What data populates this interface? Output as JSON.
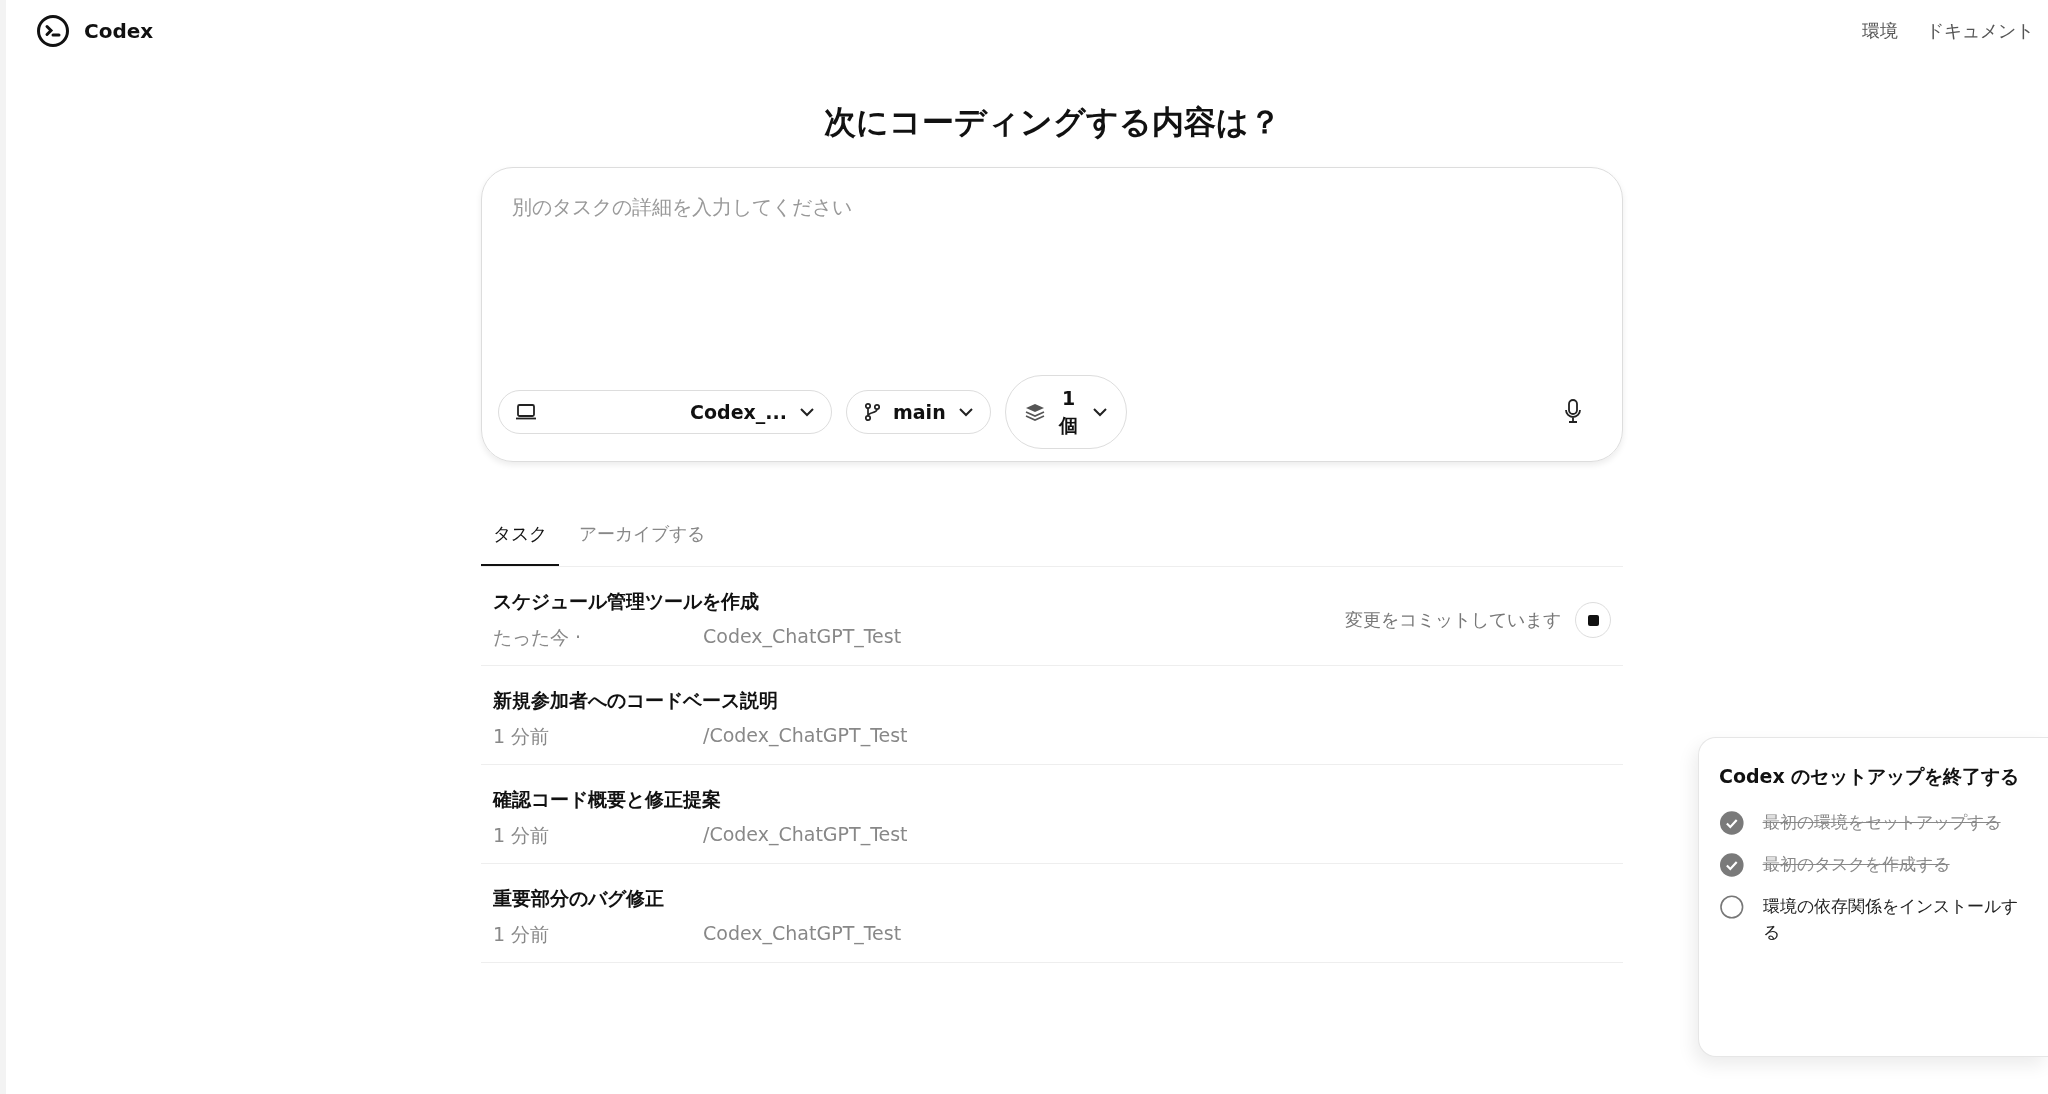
{
  "header": {
    "brand": "Codex",
    "links": [
      "環境",
      "ドキュメント"
    ]
  },
  "heading": "次にコーディングする内容は？",
  "composer": {
    "placeholder": "別のタスクの詳細を入力してください",
    "environment": "Codex_...",
    "branch": "main",
    "versions": "1 個"
  },
  "tabs": [
    {
      "label": "タスク",
      "selected": true
    },
    {
      "label": "アーカイブする",
      "selected": false
    }
  ],
  "tasks": [
    {
      "title": "スケジュール管理ツールを作成",
      "time": "たった今 ·",
      "repo": "Codex_ChatGPT_Test",
      "status": "変更をコミットしています"
    },
    {
      "title": "新規参加者へのコードベース説明",
      "time": "1 分前",
      "repo": "/Codex_ChatGPT_Test"
    },
    {
      "title": "確認コード概要と修正提案",
      "time": "1 分前",
      "repo": "/Codex_ChatGPT_Test"
    },
    {
      "title": "重要部分のバグ修正",
      "time": "1 分前",
      "repo": "Codex_ChatGPT_Test"
    }
  ],
  "setup": {
    "title": "Codex のセットアップを終了する",
    "steps": [
      {
        "label": "最初の環境をセットアップする",
        "checked": true
      },
      {
        "label": "最初のタスクを作成する",
        "checked": true
      },
      {
        "label": "環境の依存関係をインストールする",
        "checked": false
      }
    ]
  }
}
